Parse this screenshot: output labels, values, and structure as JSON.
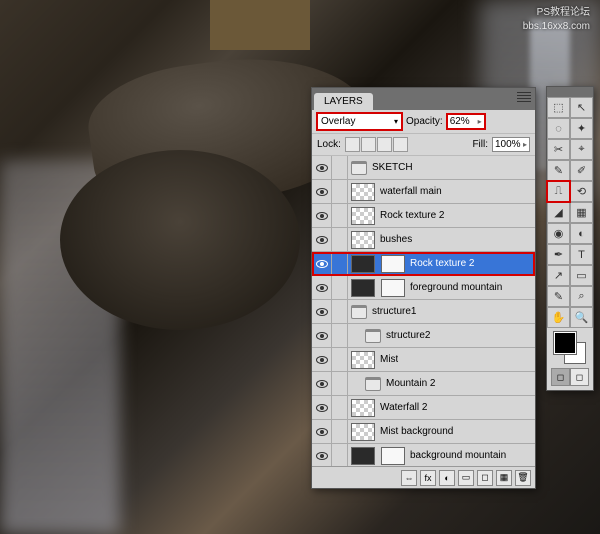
{
  "watermark": {
    "line1": "PS教程论坛",
    "line2": "bbs.16xx8.com"
  },
  "panel": {
    "title": "LAYERS",
    "blend_mode": "Overlay",
    "opacity_label": "Opacity:",
    "opacity_value": "62%",
    "lock_label": "Lock:",
    "fill_label": "Fill:",
    "fill_value": "100%"
  },
  "layers": [
    {
      "name": "SKETCH",
      "visible": true,
      "type": "folder",
      "indent": 0
    },
    {
      "name": "waterfall main",
      "visible": true,
      "type": "trans",
      "indent": 0
    },
    {
      "name": "Rock texture 2",
      "visible": true,
      "type": "trans",
      "indent": 0
    },
    {
      "name": "bushes",
      "visible": true,
      "type": "trans",
      "indent": 0
    },
    {
      "name": "Rock texture 2",
      "visible": true,
      "type": "mask",
      "indent": 0,
      "selected": true
    },
    {
      "name": "foreground mountain",
      "visible": true,
      "type": "mask",
      "indent": 0
    },
    {
      "name": "structure1",
      "visible": true,
      "type": "folder",
      "indent": 0
    },
    {
      "name": "structure2",
      "visible": true,
      "type": "folder",
      "indent": 1
    },
    {
      "name": "Mist",
      "visible": true,
      "type": "trans",
      "indent": 0
    },
    {
      "name": "Mountain 2",
      "visible": true,
      "type": "folder",
      "indent": 1
    },
    {
      "name": "Waterfall 2",
      "visible": true,
      "type": "trans",
      "indent": 0
    },
    {
      "name": "Mist background",
      "visible": true,
      "type": "trans",
      "indent": 0
    },
    {
      "name": "background mountain",
      "visible": true,
      "type": "mask",
      "indent": 0
    }
  ],
  "footer_icons": [
    "⇔",
    "fx",
    "◐",
    "▭",
    "◻",
    "▦",
    "🗑"
  ],
  "tools": [
    {
      "icon": "⬚",
      "name": "marquee"
    },
    {
      "icon": "↖",
      "name": "move"
    },
    {
      "icon": "◌",
      "name": "lasso"
    },
    {
      "icon": "✦",
      "name": "wand"
    },
    {
      "icon": "✂",
      "name": "crop"
    },
    {
      "icon": "⌖",
      "name": "slice"
    },
    {
      "icon": "✎",
      "name": "healing"
    },
    {
      "icon": "✐",
      "name": "brush"
    },
    {
      "icon": "⎍",
      "name": "stamp",
      "highlight": true
    },
    {
      "icon": "⟲",
      "name": "history"
    },
    {
      "icon": "◢",
      "name": "eraser"
    },
    {
      "icon": "▦",
      "name": "gradient"
    },
    {
      "icon": "◉",
      "name": "blur"
    },
    {
      "icon": "◐",
      "name": "dodge"
    },
    {
      "icon": "✒",
      "name": "pen"
    },
    {
      "icon": "T",
      "name": "type"
    },
    {
      "icon": "↗",
      "name": "path"
    },
    {
      "icon": "▭",
      "name": "shape"
    },
    {
      "icon": "✎",
      "name": "notes"
    },
    {
      "icon": "⌕",
      "name": "eyedropper"
    },
    {
      "icon": "✋",
      "name": "hand"
    },
    {
      "icon": "🔍",
      "name": "zoom"
    }
  ]
}
